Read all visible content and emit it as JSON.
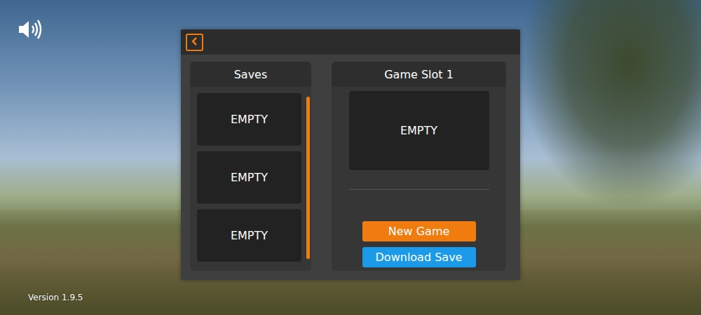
{
  "sound": {
    "muted": false
  },
  "version": "Version 1.9.5",
  "saves": {
    "title": "Saves",
    "slots": [
      {
        "label": "EMPTY"
      },
      {
        "label": "EMPTY"
      },
      {
        "label": "EMPTY"
      }
    ],
    "scrollbar": {
      "level": 1
    }
  },
  "slot_detail": {
    "title": "Game Slot 1",
    "preview": "EMPTY"
  },
  "buttons": [
    {
      "label": "New Game",
      "color": "#f07b0f"
    },
    {
      "label": "Download Save",
      "color": "#1a9ae8"
    }
  ]
}
